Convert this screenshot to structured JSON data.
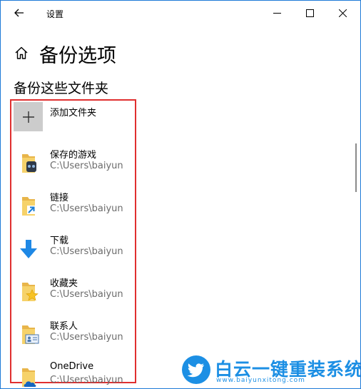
{
  "window": {
    "title": "设置",
    "accent_color": "#1f7ad8"
  },
  "page": {
    "title": "备份选项",
    "section_title": "备份这些文件夹"
  },
  "add_folder": {
    "label": "添加文件夹"
  },
  "folders": [
    {
      "name": "保存的游戏",
      "path": "C:\\Users\\baiyun",
      "icon": "saved-games-folder-icon"
    },
    {
      "name": "链接",
      "path": "C:\\Users\\baiyun",
      "icon": "links-folder-icon"
    },
    {
      "name": "下载",
      "path": "C:\\Users\\baiyun",
      "icon": "download-icon"
    },
    {
      "name": "收藏夹",
      "path": "C:\\Users\\baiyun",
      "icon": "favorites-folder-icon"
    },
    {
      "name": "联系人",
      "path": "C:\\Users\\baiyun",
      "icon": "contacts-folder-icon"
    },
    {
      "name": "OneDrive",
      "path": "C:\\Users\\baiyun",
      "icon": "onedrive-folder-icon"
    }
  ],
  "highlight_color": "#e02f2f",
  "watermark": {
    "text": "白云一键重装系统",
    "url": "www.baiyunxitong.com",
    "color": "#1c8fe4"
  }
}
